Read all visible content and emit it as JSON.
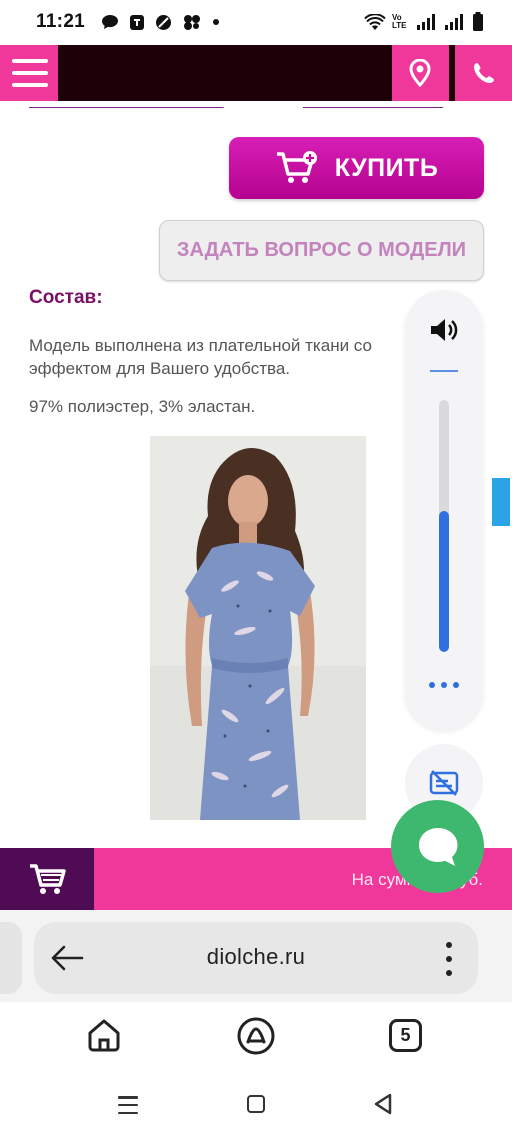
{
  "status_bar": {
    "time": "11:21",
    "network_label": "Vo LTE",
    "icons": [
      "chat-bubble-icon",
      "shield-icon",
      "block-icon",
      "app-icon",
      "dot-icon",
      "wifi-icon",
      "signal-icon",
      "signal-icon",
      "battery-icon"
    ]
  },
  "header": {
    "menu_icon": "hamburger-icon",
    "location_icon": "location-pin-icon",
    "phone_icon": "phone-icon"
  },
  "product": {
    "buy_label": "КУПИТЬ",
    "ask_label": "ЗАДАТЬ ВОПРОС О МОДЕЛИ",
    "composition_title": "Состав:",
    "composition_line1": "Модель выполнена из плательной ткани со",
    "composition_line2": "эффектом для Вашего удобства.",
    "fabric": "97% полиэстер, 3% эластан."
  },
  "volume_overlay": {
    "level": 0.56,
    "icons": [
      "speaker-icon",
      "more-dots-icon",
      "live-caption-icon"
    ]
  },
  "cart_bar": {
    "sum_text": "На сумму: 0 руб."
  },
  "browser": {
    "url": "diolche.ru",
    "tab_count": "5"
  },
  "colors": {
    "brand_pink": "#f0389a",
    "buy_magenta": "#c40aa3",
    "dark_header": "#1e0009",
    "volume_blue": "#2f6fe0",
    "chat_green": "#3fb86f"
  }
}
